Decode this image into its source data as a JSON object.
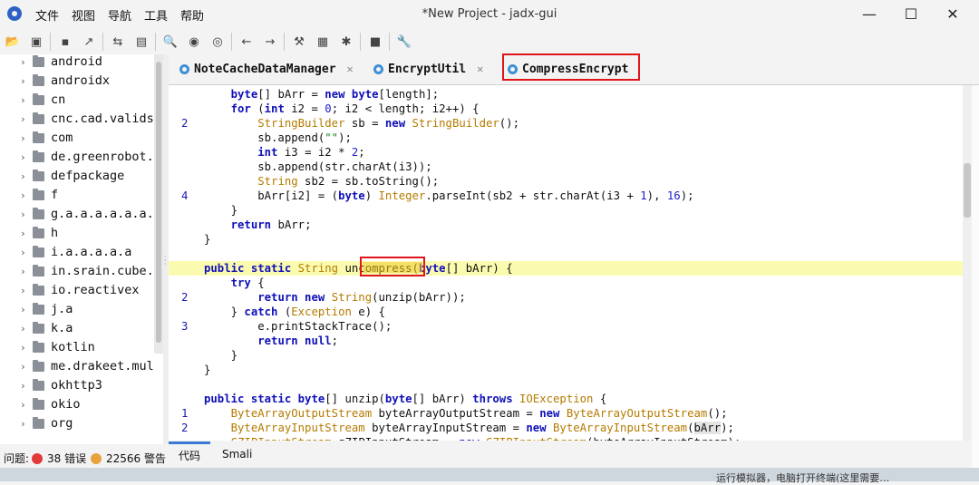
{
  "titlebar": {
    "menus": [
      "文件",
      "视图",
      "导航",
      "工具",
      "帮助"
    ],
    "title": "*New Project - jadx-gui"
  },
  "tree": {
    "items": [
      "android",
      "androidx",
      "cn",
      "cnc.cad.valids",
      "com",
      "de.greenrobot.",
      "defpackage",
      "f",
      "g.a.a.a.a.a.a.",
      "h",
      "i.a.a.a.a.a",
      "in.srain.cube.",
      "io.reactivex",
      "j.a",
      "k.a",
      "kotlin",
      "me.drakeet.mul",
      "okhttp3",
      "okio",
      "org"
    ]
  },
  "tabs": [
    {
      "label": "NoteCacheDataManager",
      "closable": true
    },
    {
      "label": "EncryptUtil",
      "closable": true
    },
    {
      "label": "CompressEncrypt",
      "closable": false,
      "active": true
    }
  ],
  "code": {
    "line_numbers": [
      "",
      "",
      "2",
      "",
      "",
      "",
      "",
      "4",
      "",
      "",
      "",
      "",
      "",
      "",
      "2",
      "",
      "3",
      "",
      "",
      "",
      "",
      "",
      "1",
      "2",
      ""
    ],
    "highlight_word": "uncompress"
  },
  "bottom_tabs": [
    "代码",
    "Smali"
  ],
  "status": {
    "label": "问题:",
    "errors": "38 错误",
    "warnings": "22566 警告"
  },
  "page_bottom_text": "运行模拟器，电脑打开终端(这里需要…",
  "colors": {
    "accent_red": "#e0161b",
    "line_highlight": "#fbfbb0",
    "keyword": "#1010b8",
    "type": "#b47b00",
    "string": "#1a8a1a"
  }
}
